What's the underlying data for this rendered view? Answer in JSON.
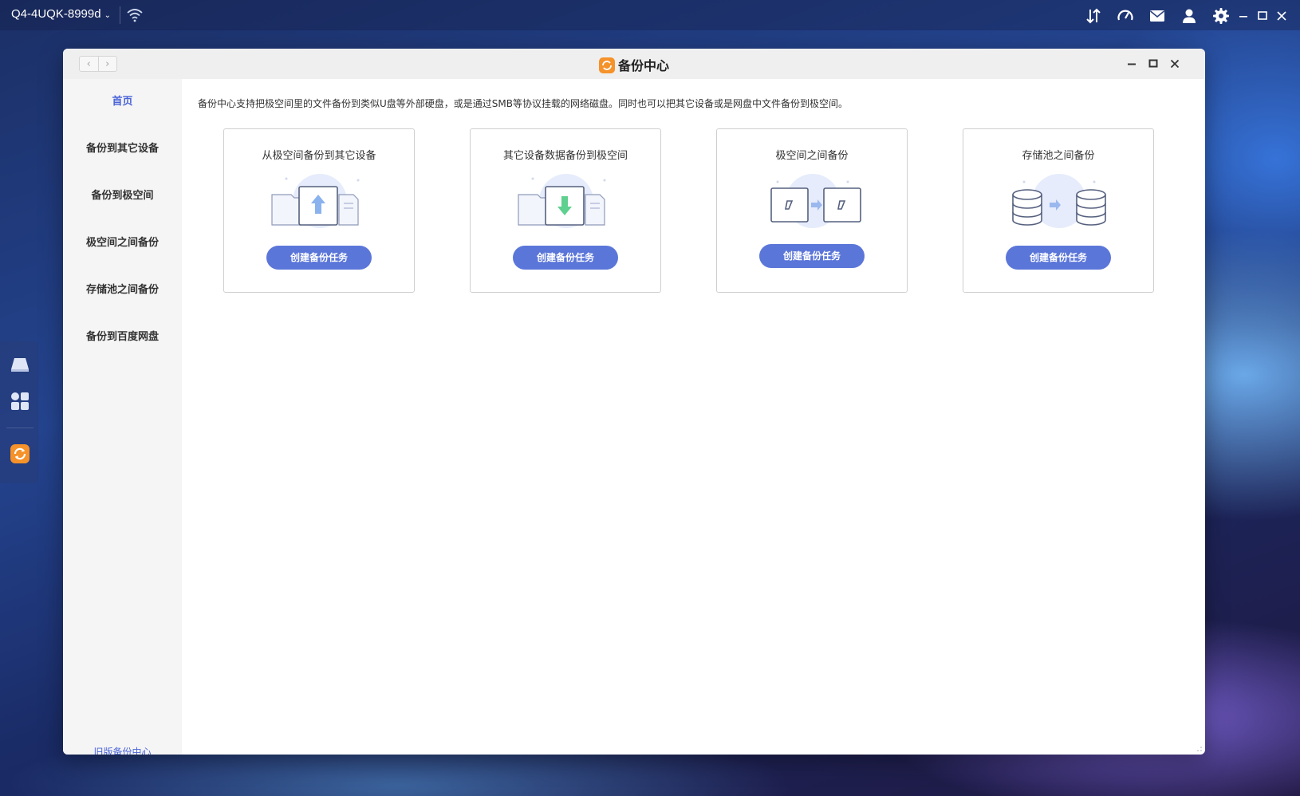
{
  "topbar": {
    "device_name": "Q4-4UQK-8999d",
    "icons": [
      "wifi-icon",
      "transfer-icon",
      "speed-gauge-icon",
      "mail-icon",
      "user-icon",
      "settings-gear-icon",
      "minimize-icon",
      "maximize-icon",
      "close-icon"
    ]
  },
  "dock": {
    "items": [
      "drive-icon",
      "apps-grid-icon",
      "backup-center-icon"
    ]
  },
  "window": {
    "title": "备份中心",
    "nav": {
      "back": "‹",
      "forward": "›"
    }
  },
  "sidebar": {
    "items": [
      {
        "label": "首页",
        "active": true
      },
      {
        "label": "备份到其它设备",
        "active": false
      },
      {
        "label": "备份到极空间",
        "active": false
      },
      {
        "label": "极空间之间备份",
        "active": false
      },
      {
        "label": "存储池之间备份",
        "active": false
      },
      {
        "label": "备份到百度网盘",
        "active": false
      }
    ],
    "old_link": "旧版备份中心"
  },
  "main": {
    "intro": "备份中心支持把极空间里的文件备份到类似U盘等外部硬盘，或是通过SMB等协议挂载的网络磁盘。同时也可以把其它设备或是网盘中文件备份到极空间。",
    "cards": [
      {
        "title": "从极空间备份到其它设备",
        "button": "创建备份任务",
        "illustration": "folder-upload-icon"
      },
      {
        "title": "其它设备数据备份到极空间",
        "button": "创建备份任务",
        "illustration": "folder-download-icon"
      },
      {
        "title": "极空间之间备份",
        "button": "创建备份任务",
        "illustration": "device-to-device-icon"
      },
      {
        "title": "存储池之间备份",
        "button": "创建备份任务",
        "illustration": "database-to-database-icon"
      }
    ]
  },
  "colors": {
    "accent": "#4a64d8",
    "button": "#5b76d9",
    "app_icon": "#f5922a"
  }
}
